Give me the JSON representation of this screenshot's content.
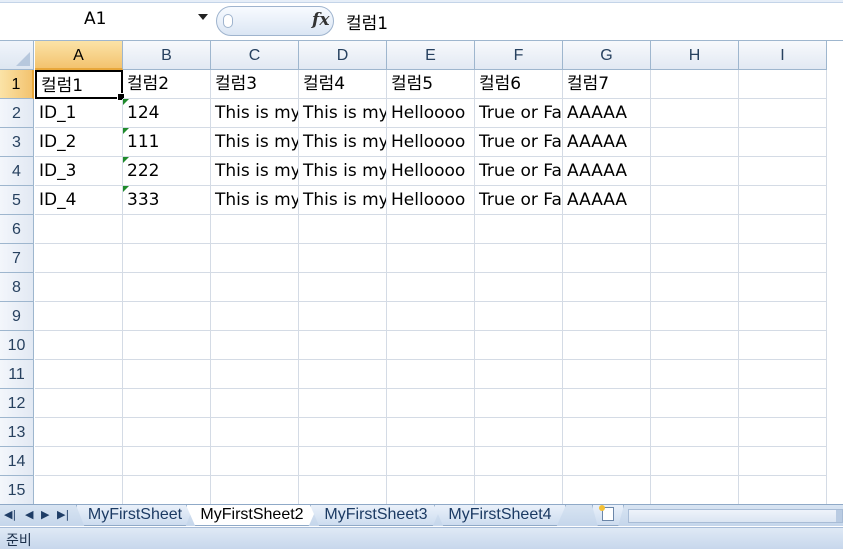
{
  "formula_bar": {
    "name_box": "A1",
    "fx_symbol": "fx",
    "formula": "컬럼1"
  },
  "grid": {
    "columns": [
      "A",
      "B",
      "C",
      "D",
      "E",
      "F",
      "G",
      "H",
      "I"
    ],
    "rows": [
      "1",
      "2",
      "3",
      "4",
      "5",
      "6",
      "7",
      "8",
      "9",
      "10",
      "11",
      "12",
      "13",
      "14",
      "15"
    ],
    "active_cell": "A1",
    "cells": [
      [
        "컬럼1",
        "컬럼2",
        "컬럼3",
        "컬럼4",
        "컬럼5",
        "컬럼6",
        "컬럼7"
      ],
      [
        "ID_1",
        "124",
        "This is my",
        "This is my",
        "Helloooo",
        "True or Fa",
        "AAAAA"
      ],
      [
        "ID_2",
        "111",
        "This is my",
        "This is my",
        "Helloooo",
        "True or Fa",
        "AAAAA"
      ],
      [
        "ID_3",
        "222",
        "This is my",
        "This is my",
        "Helloooo",
        "True or Fa",
        "AAAAA"
      ],
      [
        "ID_4",
        "333",
        "This is my",
        "This is my",
        "Helloooo",
        "True or Fa",
        "AAAAA"
      ]
    ]
  },
  "sheets": {
    "tabs": [
      "MyFirstSheet",
      "MyFirstSheet2",
      "MyFirstSheet3",
      "MyFirstSheet4"
    ],
    "active_index": 1
  },
  "status": {
    "ready": "준비"
  },
  "colors": {
    "header_bg": "#e2e9f3",
    "selected_header": "#f3c36f",
    "gridline": "#d4dbe5",
    "number_error_marker": "#1f8a2c"
  }
}
